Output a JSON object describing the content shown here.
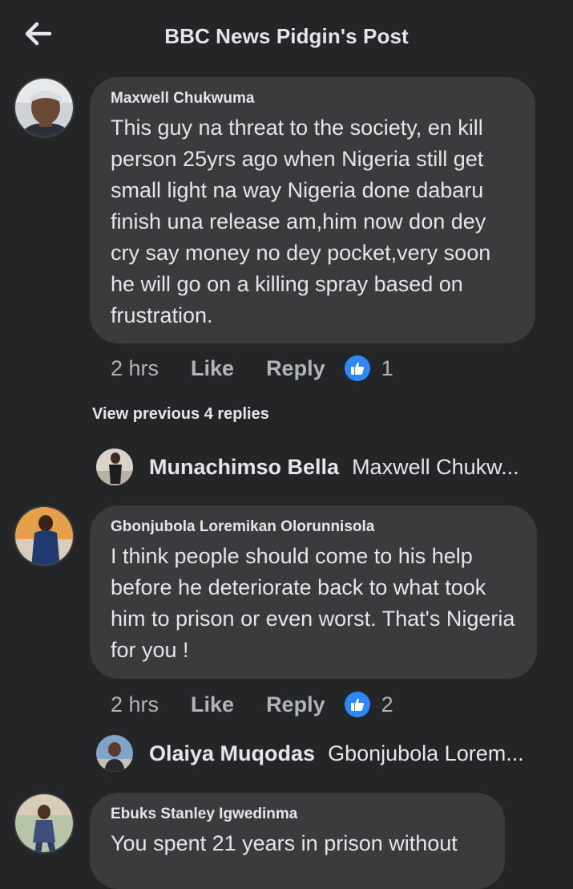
{
  "header": {
    "title": "BBC News Pidgin's Post",
    "back_icon": "arrow-left-icon"
  },
  "view_previous_replies": "View previous 4 replies",
  "comments": [
    {
      "author": "Maxwell Chukwuma",
      "text": "This guy na threat to the society, en kill person 25yrs ago when Nigeria still get small light na way Nigeria done dabaru finish una release am,him now don dey cry say money no dey pocket,very soon he will go on a killing spray based on frustration.",
      "time": "2 hrs",
      "like_label": "Like",
      "reply_label": "Reply",
      "reactions": "1"
    },
    {
      "author": "Gbonjubola Loremikan Olorunnisola",
      "text": "I think people should come to his help before he deteriorate back to what took him to prison or even worst. That's Nigeria for you !",
      "time": "2 hrs",
      "like_label": "Like",
      "reply_label": "Reply",
      "reactions": "2"
    },
    {
      "author": "Ebuks Stanley Igwedinma",
      "text": "You spent 21 years in prison without"
    }
  ],
  "replies": [
    {
      "author": "Munachimso Bella",
      "preview": "Maxwell Chukw..."
    },
    {
      "author": "Olaiya Muqodas",
      "preview": "Gbonjubola Lorem..."
    }
  ],
  "colors": {
    "background": "#242526",
    "bubble": "#3a3b3c",
    "primary_text": "#e4e6eb",
    "secondary_text": "#b0b3b8",
    "like_blue": "#2d88ff"
  }
}
